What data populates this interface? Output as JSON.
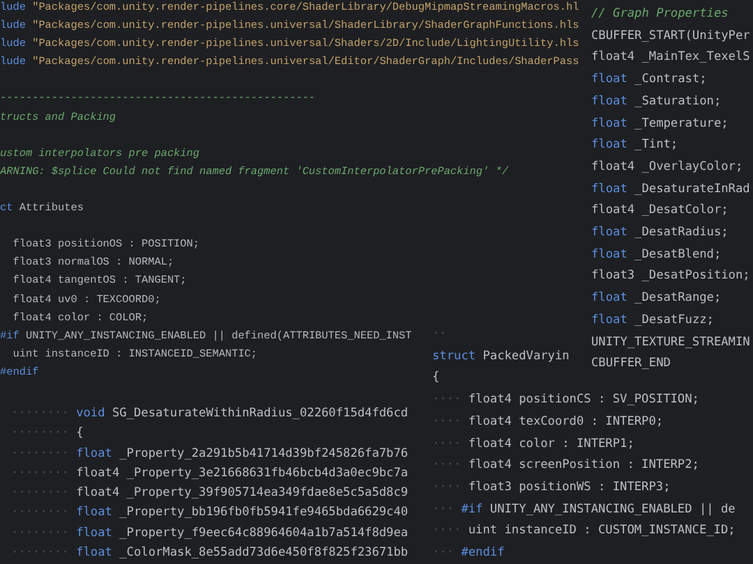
{
  "background_editor": {
    "lines": [
      {
        "kind": "code",
        "tokens": [
          {
            "kind": "directive",
            "text": "lude "
          },
          {
            "kind": "string",
            "text": "\"Packages/com.unity.render-pipelines.core/ShaderLibrary/DebugMipmapStreamingMacros.hl"
          }
        ]
      },
      {
        "kind": "code",
        "tokens": [
          {
            "kind": "directive",
            "text": "lude "
          },
          {
            "kind": "string",
            "text": "\"Packages/com.unity.render-pipelines.universal/ShaderLibrary/ShaderGraphFunctions.hls"
          }
        ]
      },
      {
        "kind": "code",
        "tokens": [
          {
            "kind": "directive",
            "text": "lude "
          },
          {
            "kind": "string",
            "text": "\"Packages/com.unity.render-pipelines.universal/Shaders/2D/Include/LightingUtility.hls"
          }
        ]
      },
      {
        "kind": "code",
        "tokens": [
          {
            "kind": "directive",
            "text": "lude "
          },
          {
            "kind": "string",
            "text": "\"Packages/com.unity.render-pipelines.universal/Editor/ShaderGraph/Includes/ShaderPass"
          }
        ]
      },
      {
        "kind": "blank"
      },
      {
        "kind": "code",
        "tokens": [
          {
            "kind": "comment",
            "text": "-------------------------------------------------"
          }
        ]
      },
      {
        "kind": "code",
        "tokens": [
          {
            "kind": "comment",
            "text": "tructs and Packing"
          }
        ]
      },
      {
        "kind": "blank"
      },
      {
        "kind": "code",
        "tokens": [
          {
            "kind": "comment",
            "text": "ustom interpolators pre packing"
          }
        ]
      },
      {
        "kind": "code",
        "tokens": [
          {
            "kind": "comment",
            "text": "ARNING: $splice Could not find named fragment 'CustomInterpolatorPrePacking' */"
          }
        ]
      },
      {
        "kind": "blank"
      },
      {
        "kind": "code",
        "tokens": [
          {
            "kind": "keyword",
            "text": "ct"
          },
          {
            "kind": "plain",
            "text": " Attributes"
          }
        ]
      },
      {
        "kind": "blank"
      },
      {
        "kind": "code",
        "tokens": [
          {
            "kind": "plain",
            "text": "  float3 positionOS : POSITION;"
          }
        ]
      },
      {
        "kind": "code",
        "tokens": [
          {
            "kind": "plain",
            "text": "  float3 normalOS : NORMAL;"
          }
        ]
      },
      {
        "kind": "code",
        "tokens": [
          {
            "kind": "plain",
            "text": "  float4 tangentOS : TANGENT;"
          }
        ]
      },
      {
        "kind": "code",
        "tokens": [
          {
            "kind": "plain",
            "text": "  float4 uv0 : TEXCOORD0;"
          }
        ]
      },
      {
        "kind": "code",
        "tokens": [
          {
            "kind": "plain",
            "text": "  float4 color : COLOR;"
          }
        ]
      },
      {
        "kind": "code",
        "tokens": [
          {
            "kind": "directive",
            "text": "#if"
          },
          {
            "kind": "plain",
            "text": " UNITY_ANY_INSTANCING_ENABLED || defined(ATTRIBUTES_NEED_INST"
          }
        ]
      },
      {
        "kind": "code",
        "tokens": [
          {
            "kind": "plain",
            "text": "  uint instanceID : INSTANCEID_SEMANTIC;"
          }
        ]
      },
      {
        "kind": "code",
        "tokens": [
          {
            "kind": "directive",
            "text": "#endif"
          }
        ]
      }
    ]
  },
  "function_panel": {
    "lines": [
      {
        "kind": "code",
        "tokens": [
          {
            "kind": "ws",
            "text": "········ "
          },
          {
            "kind": "keyword",
            "text": "void"
          },
          {
            "kind": "plain",
            "text": " SG_DesaturateWithinRadius_02260f15d4fd6cd"
          }
        ]
      },
      {
        "kind": "code",
        "tokens": [
          {
            "kind": "ws",
            "text": "········ "
          },
          {
            "kind": "plain",
            "text": "{"
          }
        ]
      },
      {
        "kind": "code",
        "tokens": [
          {
            "kind": "ws",
            "text": "········ "
          },
          {
            "kind": "keyword",
            "text": "float"
          },
          {
            "kind": "plain",
            "text": " _Property_2a291b5b41714d39bf245826fa7b76"
          }
        ]
      },
      {
        "kind": "code",
        "tokens": [
          {
            "kind": "ws",
            "text": "········ "
          },
          {
            "kind": "plain",
            "text": "float4 _Property_3e21668631fb46bcb4d3a0ec9bc7a"
          }
        ]
      },
      {
        "kind": "code",
        "tokens": [
          {
            "kind": "ws",
            "text": "········ "
          },
          {
            "kind": "plain",
            "text": "float4 _Property_39f905714ea349fdae8e5c5a5d8c9"
          }
        ]
      },
      {
        "kind": "code",
        "tokens": [
          {
            "kind": "ws",
            "text": "········ "
          },
          {
            "kind": "keyword",
            "text": "float"
          },
          {
            "kind": "plain",
            "text": " _Property_bb196fb0fb5941fe9465bda6629c40"
          }
        ]
      },
      {
        "kind": "code",
        "tokens": [
          {
            "kind": "ws",
            "text": "········ "
          },
          {
            "kind": "keyword",
            "text": "float"
          },
          {
            "kind": "plain",
            "text": " _Property_f9eec64c88964604a1b7a514f8d9ea"
          }
        ]
      },
      {
        "kind": "code",
        "tokens": [
          {
            "kind": "ws",
            "text": "········ "
          },
          {
            "kind": "keyword",
            "text": "float"
          },
          {
            "kind": "plain",
            "text": " _ColorMask_8e55add73d6e450f8f825f23671bb"
          }
        ]
      }
    ]
  },
  "struct_panel": {
    "lines": [
      {
        "kind": "code",
        "tokens": [
          {
            "kind": "ws",
            "text": "··"
          }
        ]
      },
      {
        "kind": "code",
        "tokens": [
          {
            "kind": "keyword",
            "text": "struct"
          },
          {
            "kind": "plain",
            "text": " PackedVaryin"
          }
        ]
      },
      {
        "kind": "code",
        "tokens": [
          {
            "kind": "plain",
            "text": "{"
          }
        ]
      },
      {
        "kind": "code",
        "tokens": [
          {
            "kind": "ws",
            "text": "···· "
          },
          {
            "kind": "plain",
            "text": "float4 positionCS : SV_POSITION;"
          }
        ]
      },
      {
        "kind": "code",
        "tokens": [
          {
            "kind": "ws",
            "text": "···· "
          },
          {
            "kind": "plain",
            "text": "float4 texCoord0 : INTERP0;"
          }
        ]
      },
      {
        "kind": "code",
        "tokens": [
          {
            "kind": "ws",
            "text": "···· "
          },
          {
            "kind": "plain",
            "text": "float4 color : INTERP1;"
          }
        ]
      },
      {
        "kind": "code",
        "tokens": [
          {
            "kind": "ws",
            "text": "···· "
          },
          {
            "kind": "plain",
            "text": "float4 screenPosition : INTERP2;"
          }
        ]
      },
      {
        "kind": "code",
        "tokens": [
          {
            "kind": "ws",
            "text": "···· "
          },
          {
            "kind": "plain",
            "text": "float3 positionWS : INTERP3;"
          }
        ]
      },
      {
        "kind": "code",
        "tokens": [
          {
            "kind": "ws",
            "text": "··· "
          },
          {
            "kind": "directive",
            "text": "#if"
          },
          {
            "kind": "plain",
            "text": " UNITY_ANY_INSTANCING_ENABLED || de"
          }
        ]
      },
      {
        "kind": "code",
        "tokens": [
          {
            "kind": "ws",
            "text": "···· "
          },
          {
            "kind": "plain",
            "text": "uint instanceID : CUSTOM_INSTANCE_ID;"
          }
        ]
      },
      {
        "kind": "code",
        "tokens": [
          {
            "kind": "ws",
            "text": "··· "
          },
          {
            "kind": "directive",
            "text": "#endif"
          }
        ]
      }
    ]
  },
  "properties_panel": {
    "lines": [
      {
        "kind": "code",
        "tokens": [
          {
            "kind": "comment",
            "text": "// Graph Properties"
          }
        ]
      },
      {
        "kind": "code",
        "tokens": [
          {
            "kind": "plain",
            "text": "CBUFFER_START(UnityPer"
          }
        ]
      },
      {
        "kind": "code",
        "tokens": [
          {
            "kind": "plain",
            "text": "float4 _MainTex_TexelS"
          }
        ]
      },
      {
        "kind": "code",
        "tokens": [
          {
            "kind": "keyword",
            "text": "float"
          },
          {
            "kind": "plain",
            "text": " _Contrast;"
          }
        ]
      },
      {
        "kind": "code",
        "tokens": [
          {
            "kind": "keyword",
            "text": "float"
          },
          {
            "kind": "plain",
            "text": " _Saturation;"
          }
        ]
      },
      {
        "kind": "code",
        "tokens": [
          {
            "kind": "keyword",
            "text": "float"
          },
          {
            "kind": "plain",
            "text": " _Temperature;"
          }
        ]
      },
      {
        "kind": "code",
        "tokens": [
          {
            "kind": "keyword",
            "text": "float"
          },
          {
            "kind": "plain",
            "text": " _Tint;"
          }
        ]
      },
      {
        "kind": "code",
        "tokens": [
          {
            "kind": "plain",
            "text": "float4 _OverlayColor;"
          }
        ]
      },
      {
        "kind": "code",
        "tokens": [
          {
            "kind": "keyword",
            "text": "float"
          },
          {
            "kind": "plain",
            "text": " _DesaturateInRad"
          }
        ]
      },
      {
        "kind": "code",
        "tokens": [
          {
            "kind": "plain",
            "text": "float4 _DesatColor;"
          }
        ]
      },
      {
        "kind": "code",
        "tokens": [
          {
            "kind": "keyword",
            "text": "float"
          },
          {
            "kind": "plain",
            "text": " _DesatRadius;"
          }
        ]
      },
      {
        "kind": "code",
        "tokens": [
          {
            "kind": "keyword",
            "text": "float"
          },
          {
            "kind": "plain",
            "text": " _DesatBlend;"
          }
        ]
      },
      {
        "kind": "code",
        "tokens": [
          {
            "kind": "plain",
            "text": "float3 _DesatPosition;"
          }
        ]
      },
      {
        "kind": "code",
        "tokens": [
          {
            "kind": "keyword",
            "text": "float"
          },
          {
            "kind": "plain",
            "text": " _DesatRange;"
          }
        ]
      },
      {
        "kind": "code",
        "tokens": [
          {
            "kind": "keyword",
            "text": "float"
          },
          {
            "kind": "plain",
            "text": " _DesatFuzz;"
          }
        ]
      },
      {
        "kind": "code",
        "tokens": [
          {
            "kind": "plain",
            "text": "UNITY_TEXTURE_STREAMIN"
          }
        ]
      },
      {
        "kind": "code",
        "tokens": [
          {
            "kind": "plain",
            "text": "CBUFFER_END"
          }
        ]
      }
    ]
  }
}
